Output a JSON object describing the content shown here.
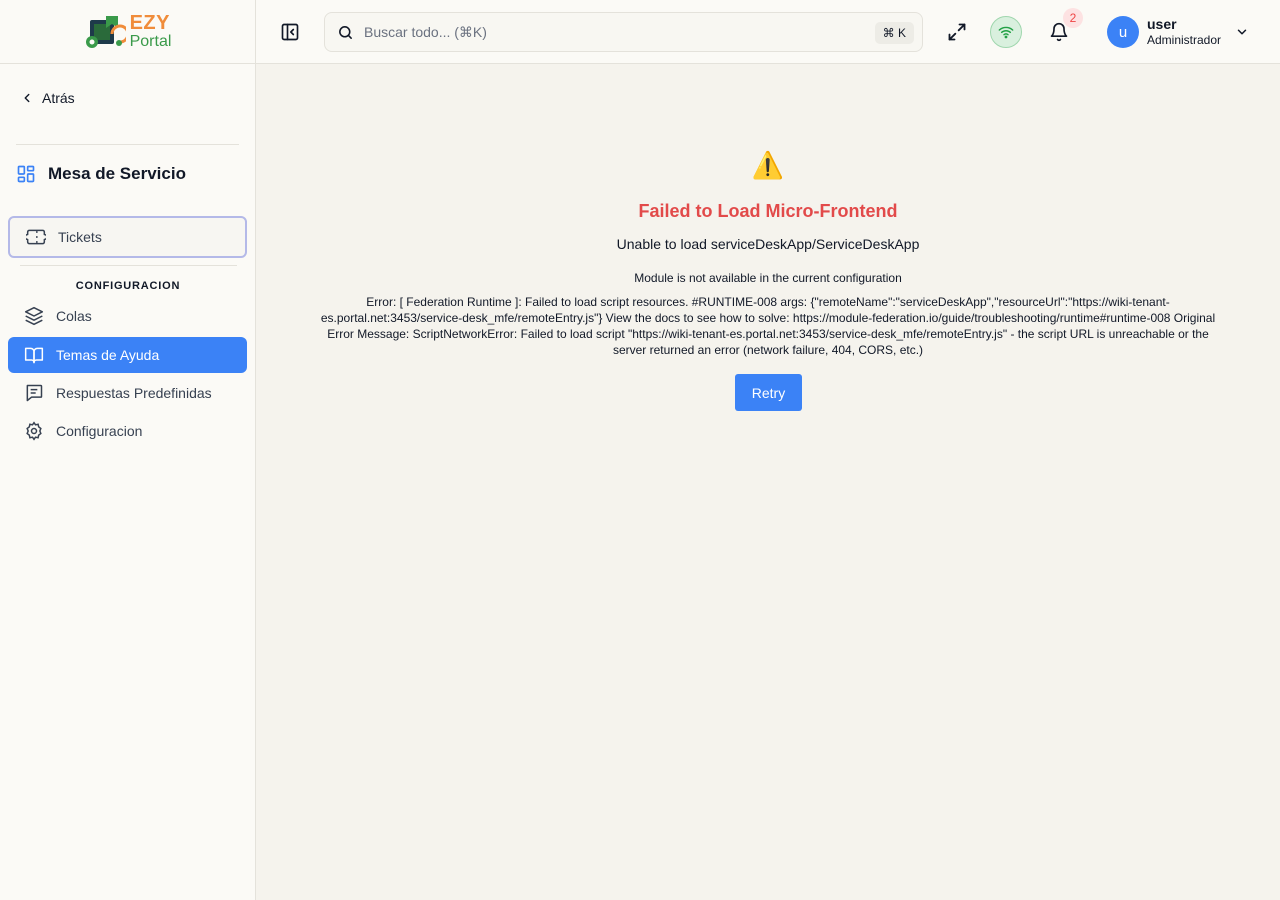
{
  "brand": {
    "line1": "EZY",
    "line2": "Portal"
  },
  "sidebar": {
    "back_label": "Atrás",
    "section_title": "Mesa de Servicio",
    "items": [
      {
        "label": "Tickets",
        "icon": "ticket-icon"
      },
      {
        "label": "Colas",
        "icon": "layers-icon"
      },
      {
        "label": "Temas de Ayuda",
        "icon": "book-icon"
      },
      {
        "label": "Respuestas Predefinidas",
        "icon": "message-lines-icon"
      },
      {
        "label": "Configuracion",
        "icon": "gear-icon"
      }
    ],
    "group_label": "CONFIGURACION",
    "active_item": "Temas de Ayuda"
  },
  "header": {
    "search_placeholder": "Buscar todo... (⌘K)",
    "shortcut": "⌘ K",
    "notification_count": "2",
    "user": {
      "initial": "u",
      "name": "user",
      "role": "Administrador"
    }
  },
  "error": {
    "icon": "⚠️",
    "title": "Failed to Load Micro-Frontend",
    "subtitle": "Unable to load serviceDeskApp/ServiceDeskApp",
    "module_message": "Module is not available in the current configuration",
    "detail": "Error: [ Federation Runtime ]: Failed to load script resources. #RUNTIME-008 args: {\"remoteName\":\"serviceDeskApp\",\"resourceUrl\":\"https://wiki-tenant-es.portal.net:3453/service-desk_mfe/remoteEntry.js\"} View the docs to see how to solve: https://module-federation.io/guide/troubleshooting/runtime#runtime-008 Original Error Message: ScriptNetworkError: Failed to load script \"https://wiki-tenant-es.portal.net:3453/service-desk_mfe/remoteEntry.js\" - the script URL is unreachable or the server returned an error (network failure, 404, CORS, etc.)",
    "retry_label": "Retry"
  },
  "colors": {
    "accent": "#3b82f6",
    "error": "#e24a4a",
    "online": "#22a045"
  }
}
